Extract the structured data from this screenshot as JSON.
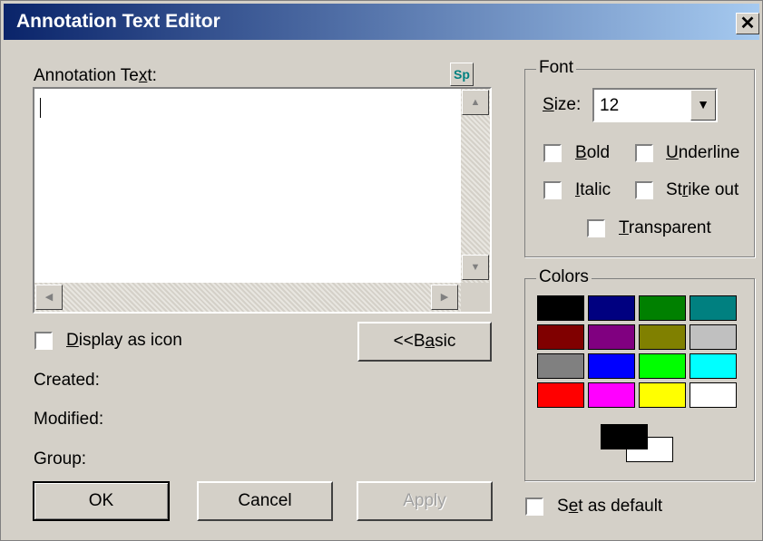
{
  "window": {
    "title": "Annotation Text Editor",
    "close_label": "✕"
  },
  "text_panel": {
    "label_prefix": "Annotation Te",
    "label_hotkey": "x",
    "label_suffix": "t:",
    "text_value": "",
    "spell_button_label": "Sp"
  },
  "display_icon": {
    "label_hotkey": "D",
    "label_rest": "isplay as icon",
    "checked": false
  },
  "basic_button": {
    "label_prefix": "<<B",
    "label_hotkey": "a",
    "label_suffix": "sic"
  },
  "info": {
    "created_label": "Created:",
    "modified_label": "Modified:",
    "group_label": "Group:"
  },
  "buttons": {
    "ok": "OK",
    "cancel": "Cancel",
    "apply": "Apply"
  },
  "font": {
    "group_label": "Font",
    "size_label_hotkey": "S",
    "size_label_rest": "ize:",
    "size_value": "12",
    "bold": {
      "hotkey": "B",
      "rest": "old",
      "checked": false
    },
    "underline": {
      "hotkey": "U",
      "rest": "nderline",
      "checked": false
    },
    "italic": {
      "hotkey": "I",
      "rest": "talic",
      "checked": false
    },
    "strikeout": {
      "prefix": "St",
      "hotkey": "r",
      "rest": "ike out",
      "checked": false
    },
    "transparent": {
      "hotkey": "T",
      "rest": "ransparent",
      "checked": false
    }
  },
  "colors": {
    "group_label": "Colors",
    "palette": [
      "#000000",
      "#000080",
      "#008000",
      "#008080",
      "#800000",
      "#800080",
      "#808000",
      "#c0c0c0",
      "#808080",
      "#0000ff",
      "#00ff00",
      "#00ffff",
      "#ff0000",
      "#ff00ff",
      "#ffff00",
      "#ffffff"
    ],
    "foreground": "#000000",
    "background": "#ffffff"
  },
  "set_default": {
    "prefix": "S",
    "hotkey": "e",
    "rest": "t as default",
    "checked": false
  }
}
